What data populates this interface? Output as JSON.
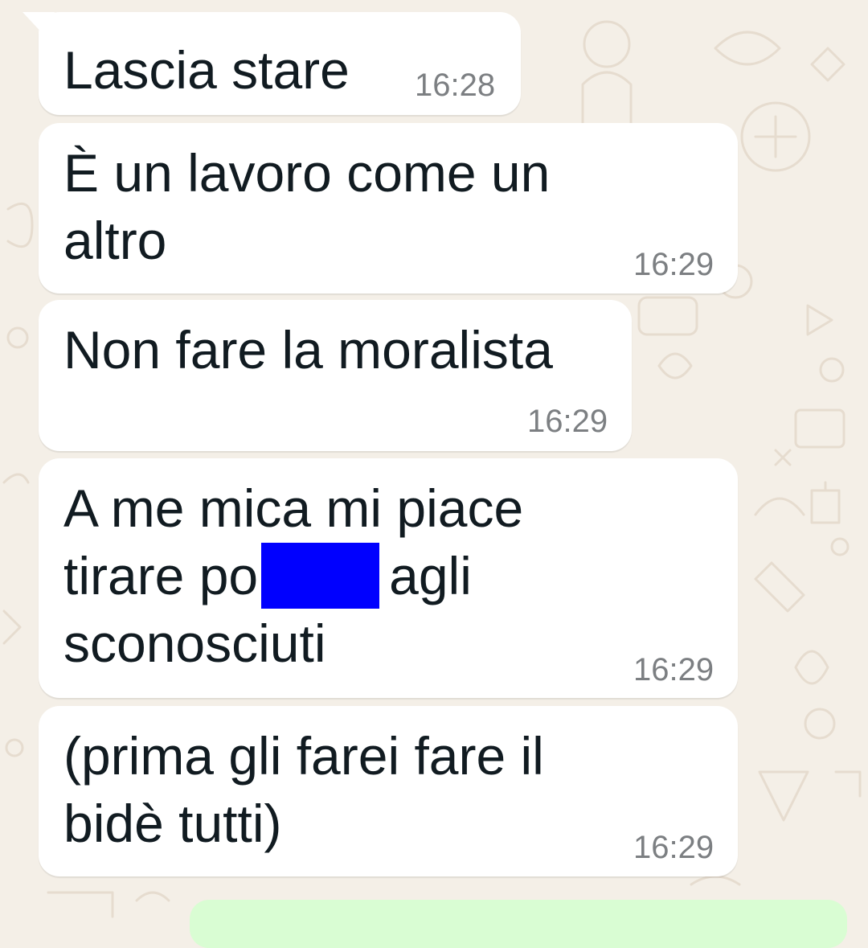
{
  "chat": {
    "messages": [
      {
        "lines": [
          "Lascia stare"
        ],
        "time": "16:28"
      },
      {
        "lines": [
          "È un lavoro come un",
          "altro"
        ],
        "time": "16:29"
      },
      {
        "lines": [
          "Non fare la moralista"
        ],
        "time": "16:29"
      },
      {
        "lines": [
          "A me mica mi piace",
          "tirare po",
          "agli",
          "sconosciuti"
        ],
        "time": "16:29"
      },
      {
        "lines": [
          "(prima gli farei fare il",
          "bidè tutti)"
        ],
        "time": "16:29"
      }
    ]
  },
  "colors": {
    "background": "#f4efe7",
    "incoming_bubble": "#ffffff",
    "outgoing_bubble": "#d9fdd3",
    "text": "#111b21",
    "timestamp": "#7c7f82",
    "redaction": "#0000ff"
  }
}
